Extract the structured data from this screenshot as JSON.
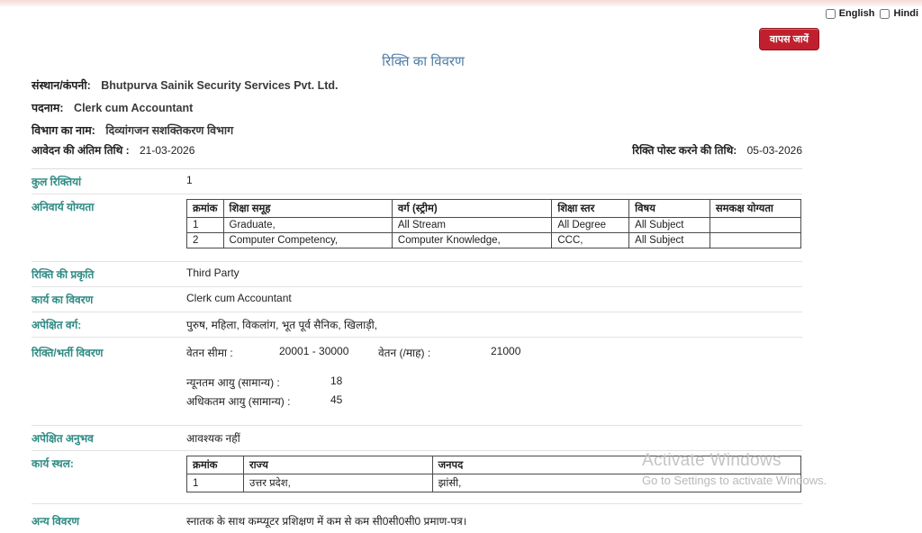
{
  "page": {
    "title": "रिक्ति का विवरण",
    "back_button_label": "वापस जायें"
  },
  "lang_toggle": {
    "english_label": "English",
    "hindi_label": "Hindi"
  },
  "header_fields": {
    "company_label": "संस्थान/कंपनी:",
    "company_value": "Bhutpurva Sainik Security Services Pvt. Ltd.",
    "position_label": "पदनाम:",
    "position_value": "Clerk cum Accountant",
    "department_label": "विभाग का नाम:",
    "department_value": "दिव्यांगजन सशक्तिकरण विभाग",
    "last_date_label": "आवेदन की अंतिम तिथि :",
    "last_date_value": "21-03-2026",
    "post_date_label": "रिक्ति पोस्ट करने की तिथि:",
    "post_date_value": "05-03-2026"
  },
  "details": {
    "total_vacancies_label": "कुल रिक्तियां",
    "total_vacancies_value": "1",
    "mandatory_qualification_label": "अनिवार्य योग्यता",
    "qualification_table": {
      "headers": [
        "क्रमांक",
        "शिक्षा समूह",
        "वर्ग (स्ट्रीम)",
        "शिक्षा स्तर",
        "विषय",
        "समकक्ष योग्यता"
      ],
      "rows": [
        [
          "1",
          "Graduate,",
          "All Stream",
          "All Degree",
          "All Subject",
          ""
        ],
        [
          "2",
          "Computer Competency,",
          "Computer Knowledge,",
          "CCC,",
          "All Subject",
          ""
        ]
      ]
    },
    "nature_label": "रिक्ति की प्रकृति",
    "nature_value": "Third Party",
    "job_desc_label": "कार्य का विवरण",
    "job_desc_value": "Clerk cum Accountant",
    "expected_category_label": "अपेक्षित वर्ग:",
    "expected_category_value": "पुरुष, महिला, विकलांग, भूत पूर्व सैनिक, खिलाड़ी,",
    "recruitment_label": "रिक्ति/भर्ती विवरण",
    "salary_range_label": "वेतन सीमा :",
    "salary_range_value": "20001 - 30000",
    "salary_month_label": "वेतन (/माह) :",
    "salary_month_value": "21000",
    "min_age_label": "न्यूनतम आयु (सामान्य)   :",
    "min_age_value": "18",
    "max_age_label": "अधिकतम आयु (सामान्य) :",
    "max_age_value": "45",
    "experience_label": "अपेक्षित अनुभव",
    "experience_value": "आवश्यक नहीं",
    "workplace_label": "कार्य स्थल:",
    "workplace_table": {
      "headers": [
        "क्रमांक",
        "राज्य",
        "जनपद"
      ],
      "rows": [
        [
          "1",
          "उत्तर प्रदेश,",
          "झांसी,"
        ]
      ]
    },
    "other_label": "अन्य विवरण",
    "other_value": "स्नातक के साथ कम्प्यूटर प्रशिक्षण में कम से कम सी0सी0सी0 प्रमाण-पत्र।"
  },
  "watermark": {
    "line1": "Activate Windows",
    "line2": "Go to Settings to activate Windows."
  },
  "colors": {
    "accent_teal": "#2e8b84",
    "title_blue": "#4e7ca3",
    "button_red": "#c0202d"
  }
}
